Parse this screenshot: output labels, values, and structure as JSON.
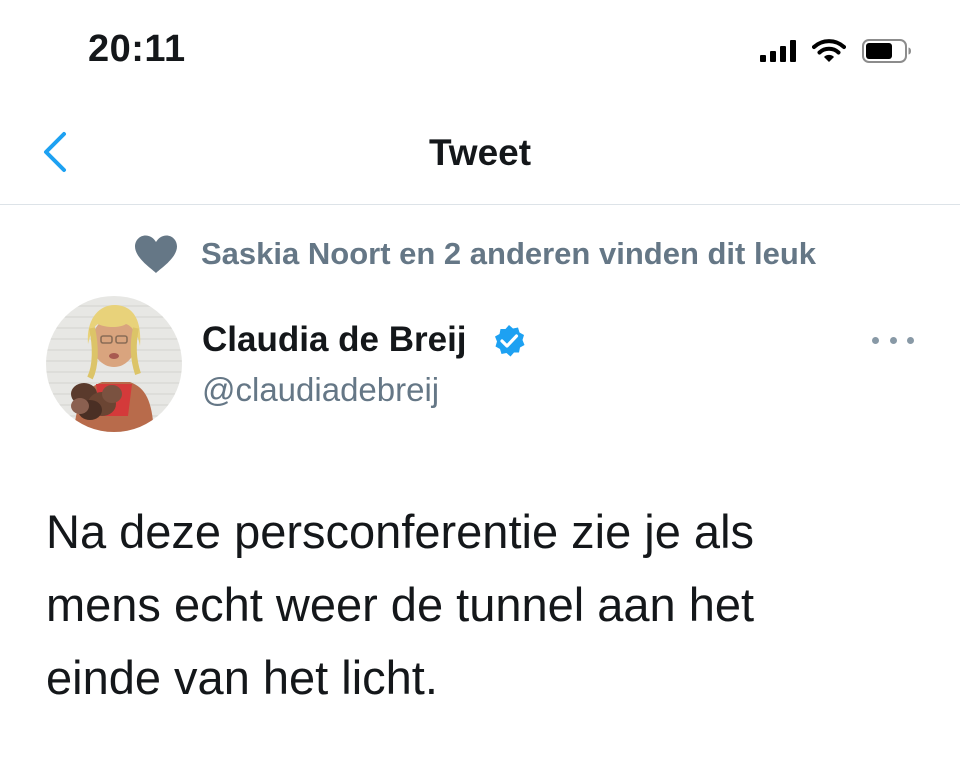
{
  "status_bar": {
    "time": "20:11",
    "icons": [
      "cellular-signal-icon",
      "wifi-icon",
      "battery-icon"
    ]
  },
  "nav": {
    "back_icon": "chevron-left-icon",
    "title": "Tweet",
    "accent_color": "#1da1f2"
  },
  "likes": {
    "icon": "heart-icon",
    "text": "Saskia Noort en 2 anderen vinden dit leuk"
  },
  "tweet": {
    "author": {
      "display_name": "Claudia de Breij",
      "handle": "@claudiadebreij",
      "verified": true,
      "avatar": "avatar-photo"
    },
    "more_icon": "more-options-icon",
    "lines": [
      "Na deze persconferentie zie je als",
      "mens echt weer de tunnel aan het",
      "einde van het licht."
    ]
  },
  "colors": {
    "text": "#14171a",
    "secondary": "#657786",
    "divider": "#dde3e8",
    "verified": "#1da1f2"
  }
}
